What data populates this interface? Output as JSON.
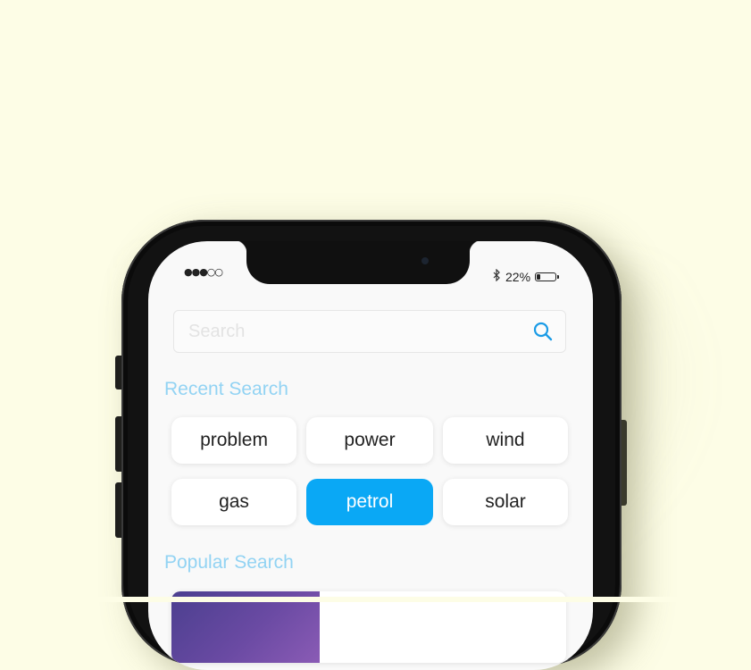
{
  "status_bar": {
    "signal": "●●●○○",
    "battery_percent": "22%",
    "battery_level": 0.22,
    "bluetooth_icon": "bluetooth-icon"
  },
  "search": {
    "placeholder": "Search",
    "value": "",
    "icon": "search-icon"
  },
  "recent_search": {
    "title": "Recent Search",
    "items": [
      {
        "label": "problem",
        "active": false
      },
      {
        "label": "power",
        "active": false
      },
      {
        "label": "wind",
        "active": false
      },
      {
        "label": "gas",
        "active": false
      },
      {
        "label": "petrol",
        "active": true
      },
      {
        "label": "solar",
        "active": false
      }
    ]
  },
  "popular_search": {
    "title": "Popular Search"
  },
  "colors": {
    "background": "#fdfde6",
    "accent": "#0aa8f5",
    "section_title": "#92d3f3",
    "screen": "#f9f9f9"
  }
}
